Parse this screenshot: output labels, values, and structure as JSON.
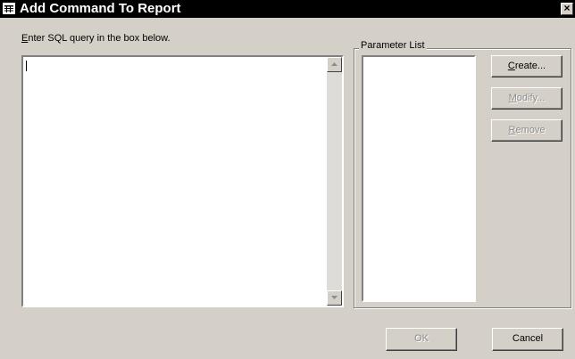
{
  "window": {
    "title": "Add Command To Report",
    "close_glyph": "×",
    "icon": "app-window-icon"
  },
  "sql": {
    "prompt_mnemonic": "E",
    "prompt_rest": "nter SQL query in the box below.",
    "value": ""
  },
  "parameters": {
    "group_label": "Parameter List",
    "items": []
  },
  "buttons": {
    "create": {
      "mnemonic": "C",
      "rest": "reate...",
      "enabled": true
    },
    "modify": {
      "mnemonic": "M",
      "rest": "odify...",
      "enabled": false
    },
    "remove": {
      "mnemonic": "R",
      "rest": "emove",
      "enabled": false
    },
    "ok": {
      "label": "OK",
      "enabled": false
    },
    "cancel": {
      "label": "Cancel",
      "enabled": true
    }
  },
  "colors": {
    "titlebar": "#000000",
    "dialog_face": "#d4d0c8",
    "disabled_text": "#8d8d8d"
  }
}
